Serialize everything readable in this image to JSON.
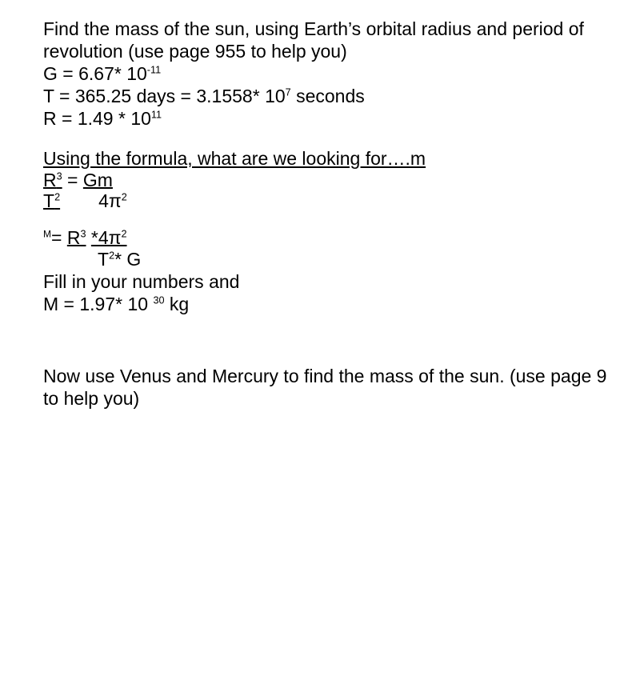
{
  "document": {
    "type": "slide",
    "background_color": "#ffffff",
    "text_color": "#000000"
  },
  "body": {
    "intro_line_1": "Find the mass of the sun, using Earth’s orbital radius and period of",
    "intro_line_2": "revolution  (use page 955 to help you)",
    "given_g": {
      "prefix": "G = 6.67* 10",
      "exponent": "-11"
    },
    "given_t": {
      "prefix": "T = 365.25 days = 3.1558* 10",
      "exponent": "7",
      "suffix": "  seconds"
    },
    "given_r": {
      "prefix": "R =  1.49 * 10",
      "exponent": "11"
    },
    "question_line": "Using the formula, what are we looking for….m",
    "formula_1": {
      "numerator_left": "R",
      "numerator_left_exp": "3",
      "equals": "=",
      "numerator_right": "Gm",
      "denominator_left": "T",
      "denominator_left_exp": "2",
      "denominator_right": "4π",
      "denominator_right_exp": "2"
    },
    "formula_2": {
      "m_label": "M",
      "equals": "=",
      "numerator": "R",
      "numerator_exp": "3",
      "numerator_rest": "*4π",
      "numerator_rest_exp": "2",
      "denominator": "T",
      "denominator_exp": "2",
      "denominator_rest": "*  G"
    },
    "fill_in_line": "Fill in your numbers and",
    "answer": {
      "prefix": "M = 1.97* 10 ",
      "exponent": "30",
      "suffix": "  kg"
    },
    "closing_line_1": "Now use Venus and Mercury to find the mass of the sun.  (use page 9",
    "closing_line_2": "to help you)"
  }
}
